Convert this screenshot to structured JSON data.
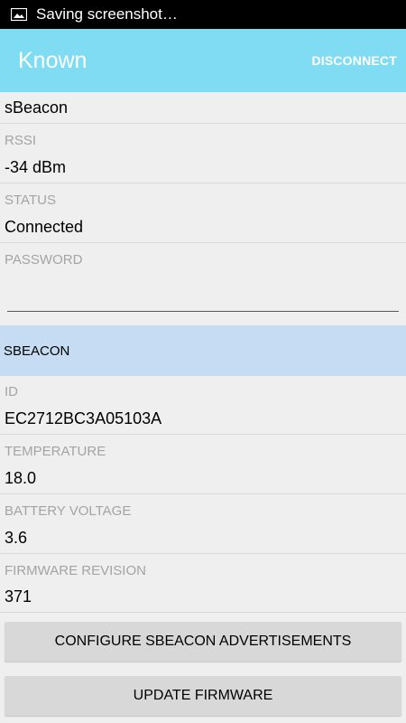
{
  "status_bar": {
    "text": "Saving screenshot…",
    "icon": "image-icon"
  },
  "action_bar": {
    "title": "Known",
    "disconnect_label": "DISCONNECT"
  },
  "device": {
    "name": "sBeacon",
    "rssi_label": "RSSI",
    "rssi_value": "-34 dBm",
    "status_label": "STATUS",
    "status_value": "Connected",
    "password_label": "PASSWORD",
    "password_value": ""
  },
  "section": {
    "title": "SBEACON"
  },
  "sbeacon": {
    "id_label": "ID",
    "id_value": "EC2712BC3A05103A",
    "temperature_label": "TEMPERATURE",
    "temperature_value": "18.0",
    "battery_label": "BATTERY VOLTAGE",
    "battery_value": "3.6",
    "firmware_label": "FIRMWARE REVISION",
    "firmware_value": "371"
  },
  "buttons": {
    "configure_label": "CONFIGURE SBEACON ADVERTISEMENTS",
    "update_label": "UPDATE FIRMWARE"
  },
  "colors": {
    "action_bar": "#80dcf2",
    "section_header": "#c5dcf2",
    "background": "#efefef"
  }
}
